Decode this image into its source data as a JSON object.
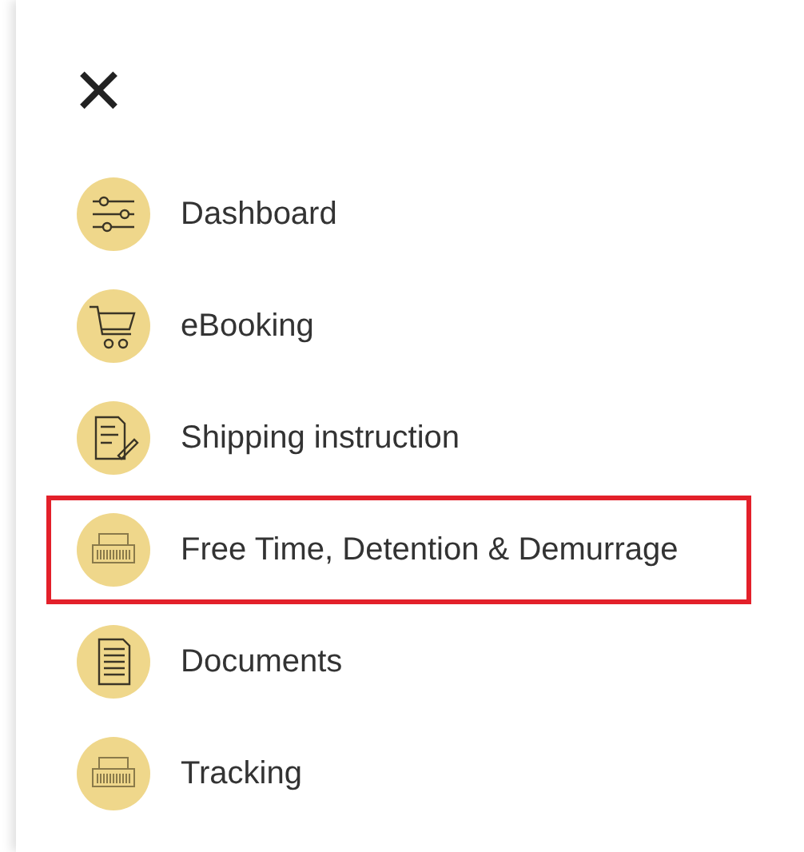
{
  "close_button": "✕",
  "menu_items": [
    {
      "label": "Dashboard",
      "highlighted": false
    },
    {
      "label": "eBooking",
      "highlighted": false
    },
    {
      "label": "Shipping instruction",
      "highlighted": false
    },
    {
      "label": "Free Time, Detention & Demurrage",
      "highlighted": true
    },
    {
      "label": "Documents",
      "highlighted": false
    },
    {
      "label": "Tracking",
      "highlighted": false
    }
  ]
}
